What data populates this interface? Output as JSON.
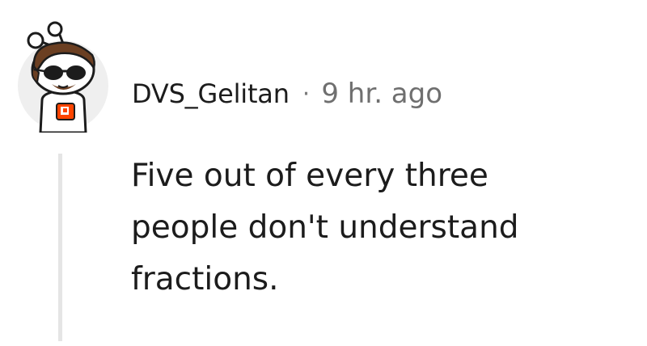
{
  "comment": {
    "username": "DVS_Gelitan",
    "separator": "·",
    "timestamp": "9 hr. ago",
    "body_lines": [
      "Five out of every three",
      "people don't understand",
      "fractions."
    ],
    "avatar": {
      "icon": "snoo-avatar-icon",
      "accent_color": "#ff4500",
      "hair_color": "#6b3f22"
    }
  }
}
